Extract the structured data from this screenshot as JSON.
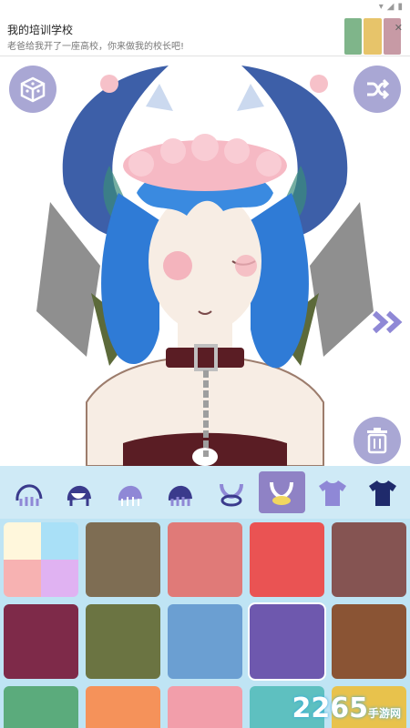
{
  "notification": {
    "title": "我的培训学校",
    "subtitle": "老爸给我开了一座高校，你来做我的校长吧!",
    "close_symbol": "✕"
  },
  "canvas": {
    "actions": {
      "randomize_icon": "dice-cube-icon",
      "shuffle_icon": "shuffle-icon",
      "next_icon": "double-chevron-right-icon",
      "delete_icon": "trash-icon"
    }
  },
  "tabs": [
    {
      "icon": "hair-front-1-icon",
      "active": false
    },
    {
      "icon": "hair-front-2-icon",
      "active": false
    },
    {
      "icon": "hair-front-3-icon",
      "active": false
    },
    {
      "icon": "hair-front-4-icon",
      "active": false
    },
    {
      "icon": "horns-icon",
      "active": false
    },
    {
      "icon": "horns-color-icon",
      "active": true
    },
    {
      "icon": "shirt-icon",
      "active": false
    },
    {
      "icon": "shirt-dark-icon",
      "active": false
    }
  ],
  "palette": [
    "#multi",
    "#7e6d53",
    "#e07a78",
    "#ea5353",
    "#855452",
    "#7e2a49",
    "#6b7442",
    "#6b9fd2",
    "#6e58ae",
    "#8a5434",
    "#5bab7c",
    "#f5925a",
    "#f29eaa",
    "#5ec0c0",
    "#e8c24c"
  ],
  "watermark": {
    "number": "2265",
    "site": "手游网"
  }
}
